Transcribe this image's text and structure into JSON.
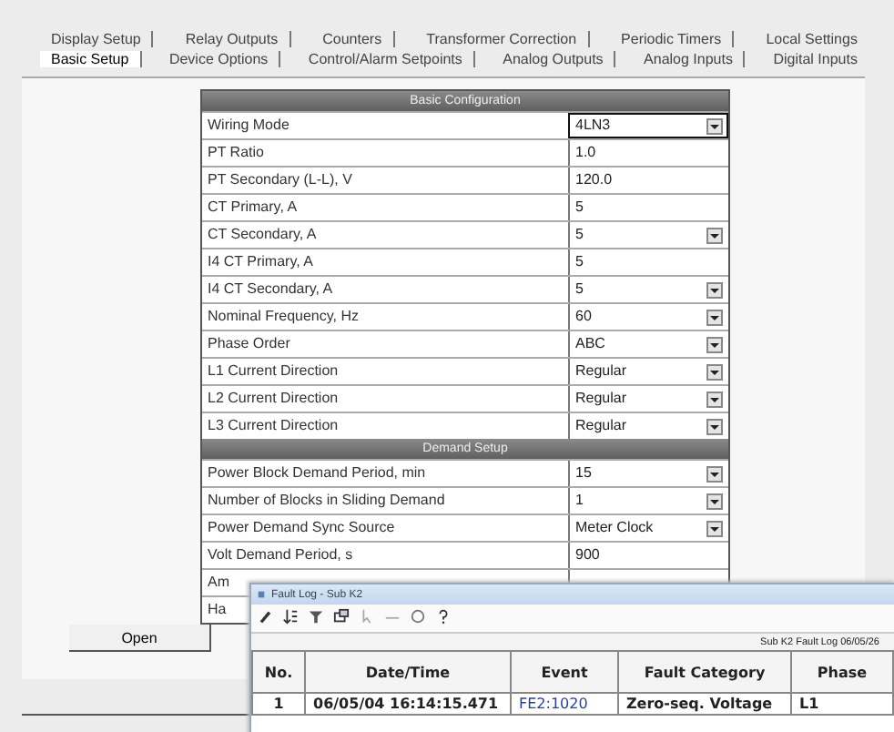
{
  "tabs_back": [
    {
      "label": "Display Setup",
      "selected": false
    },
    {
      "label": "Relay Outputs",
      "selected": false
    },
    {
      "label": "Counters",
      "selected": false
    },
    {
      "label": "Transformer Correction",
      "selected": false
    },
    {
      "label": "Periodic Timers",
      "selected": false
    },
    {
      "label": "Local Settings",
      "selected": false
    }
  ],
  "tabs_front": [
    {
      "label": "Basic Setup",
      "selected": true
    },
    {
      "label": "Device Options",
      "selected": false
    },
    {
      "label": "Control/Alarm Setpoints",
      "selected": false
    },
    {
      "label": "Analog Outputs",
      "selected": false
    },
    {
      "label": "Analog Inputs",
      "selected": false
    },
    {
      "label": "Digital Inputs",
      "selected": false
    }
  ],
  "sections": [
    {
      "title": "Basic Configuration",
      "rows": [
        {
          "label": "Wiring Mode",
          "value": "4LN3",
          "kind": "dropdown",
          "focused": true
        },
        {
          "label": "PT Ratio",
          "value": "1.0",
          "kind": "text",
          "focused": false
        },
        {
          "label": "PT Secondary (L-L), V",
          "value": "120.0",
          "kind": "text",
          "focused": false
        },
        {
          "label": "CT Primary, A",
          "value": "5",
          "kind": "text",
          "focused": false
        },
        {
          "label": "CT Secondary, A",
          "value": "5",
          "kind": "dropdown",
          "focused": false
        },
        {
          "label": "I4 CT Primary, A",
          "value": "5",
          "kind": "text",
          "focused": false
        },
        {
          "label": "I4 CT Secondary, A",
          "value": "5",
          "kind": "dropdown",
          "focused": false
        },
        {
          "label": "Nominal Frequency, Hz",
          "value": "60",
          "kind": "dropdown",
          "focused": false
        },
        {
          "label": "Phase Order",
          "value": "ABC",
          "kind": "dropdown",
          "focused": false
        },
        {
          "label": "L1 Current Direction",
          "value": "Regular",
          "kind": "dropdown",
          "focused": false
        },
        {
          "label": "L2 Current Direction",
          "value": "Regular",
          "kind": "dropdown",
          "focused": false
        },
        {
          "label": "L3 Current Direction",
          "value": "Regular",
          "kind": "dropdown",
          "focused": false
        }
      ]
    },
    {
      "title": "Demand Setup",
      "rows": [
        {
          "label": "Power Block Demand Period, min",
          "value": "15",
          "kind": "dropdown",
          "focused": false
        },
        {
          "label": "Number of Blocks in Sliding Demand",
          "value": "1",
          "kind": "dropdown",
          "focused": false
        },
        {
          "label": "Power Demand Sync Source",
          "value": "Meter Clock",
          "kind": "dropdown",
          "focused": false
        },
        {
          "label": "Volt Demand Period, s",
          "value": "900",
          "kind": "text",
          "focused": false
        },
        {
          "label": "Am",
          "kind": "partial"
        },
        {
          "label": "Ha",
          "kind": "partial"
        }
      ]
    }
  ],
  "open_button": "Open",
  "fault_log": {
    "title": "Fault Log - Sub K2",
    "info": "Sub K2  Fault Log  06/05/26",
    "columns": [
      "No.",
      "Date/Time",
      "Event",
      "Fault Category",
      "Phase"
    ],
    "rows": [
      {
        "no": "1",
        "datetime": "06/05/04  16:14:15.471",
        "event": "FE2:1020",
        "category": "Zero-seq. Voltage",
        "phase": "L1"
      }
    ]
  }
}
